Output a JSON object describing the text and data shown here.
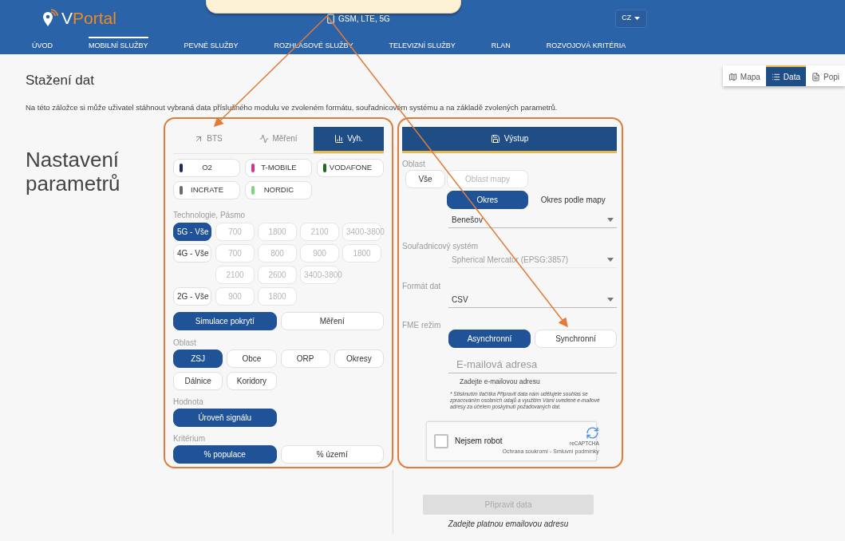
{
  "header": {
    "logo": {
      "initial": "V",
      "name": "Portal"
    },
    "network": "GSM, LTE, 5G",
    "language": "CZ"
  },
  "nav": [
    {
      "label": "ÚVOD",
      "selected": false
    },
    {
      "label": "MOBILNÍ SLUŽBY",
      "selected": true
    },
    {
      "label": "PEVNÉ SLUŽBY",
      "selected": false
    },
    {
      "label": "ROZHLASOVÉ SLUŽBY",
      "selected": false
    },
    {
      "label": "TELEVIZNÍ SLUŽBY",
      "selected": false
    },
    {
      "label": "RLAN",
      "selected": false
    },
    {
      "label": "ROZVOJOVÁ KRITÉRIA",
      "selected": false
    }
  ],
  "view_tabs": [
    {
      "kind": "map",
      "label": "Mapa",
      "selected": false
    },
    {
      "kind": "list",
      "label": "Data",
      "selected": true
    },
    {
      "kind": "document",
      "label": "Popi",
      "selected": false
    }
  ],
  "page": {
    "title": "Stažení dat",
    "description": "Na této záložce si může uživatel stáhnout vybraná data příslušného modulu ve zvoleném formátu, souřadnicovém systému a na základě zvolených parametrů.",
    "heading": "Nastavení parametrů"
  },
  "parameters": {
    "tabs": [
      {
        "kind": "bts",
        "label": "BTS",
        "selected": false
      },
      {
        "kind": "measurement",
        "label": "Měření",
        "selected": false
      },
      {
        "kind": "results",
        "label": "Vyh.",
        "selected": true
      }
    ],
    "operators": [
      {
        "name": "O2",
        "color": "#1a2a6c"
      },
      {
        "name": "T-MOBILE",
        "color": "#d6338a"
      },
      {
        "name": "VODAFONE",
        "color": "#1e6b1e"
      },
      {
        "name": "INCRATE",
        "color": "#6b6b6b"
      },
      {
        "name": "NORDIC",
        "color": "#7fd67f"
      }
    ],
    "technology": {
      "label": "Technologie, Pásmo",
      "rows": [
        {
          "generation": {
            "label": "5G - Vše",
            "selected": true
          },
          "bands": [
            {
              "label": "700",
              "disabled": true
            },
            {
              "label": "1800",
              "disabled": true
            },
            {
              "label": "2100",
              "disabled": true
            },
            {
              "label": "3400-3800",
              "disabled": true
            }
          ]
        },
        {
          "generation": {
            "label": "4G - Vše",
            "selected": false
          },
          "bands": [
            {
              "label": "700",
              "disabled": true
            },
            {
              "label": "800",
              "disabled": true
            },
            {
              "label": "900",
              "disabled": true
            },
            {
              "label": "1800",
              "disabled": true
            },
            {
              "label": "2100",
              "disabled": true
            },
            {
              "label": "2600",
              "disabled": true
            },
            {
              "label": "3400-3800",
              "disabled": true
            }
          ]
        },
        {
          "generation": {
            "label": "2G - Vše",
            "selected": false
          },
          "bands": [
            {
              "label": "900",
              "disabled": true
            },
            {
              "label": "1800",
              "disabled": true
            }
          ]
        }
      ]
    },
    "data_source": [
      {
        "label": "Simulace pokrytí",
        "selected": true
      },
      {
        "label": "Měření",
        "selected": false
      }
    ],
    "area": {
      "label": "Oblast",
      "options": [
        {
          "label": "ZSJ",
          "selected": true
        },
        {
          "label": "Obce",
          "selected": false
        },
        {
          "label": "ORP",
          "selected": false
        },
        {
          "label": "Okresy",
          "selected": false
        },
        {
          "label": "Dálnice",
          "selected": false
        },
        {
          "label": "Koridory",
          "selected": false
        }
      ]
    },
    "value": {
      "label": "Hodnota",
      "options": [
        {
          "label": "Úroveň signálu",
          "selected": true
        }
      ]
    },
    "criterion": {
      "label": "Kritérium",
      "options": [
        {
          "label": "% populace",
          "selected": true
        },
        {
          "label": "% území",
          "selected": false
        }
      ]
    }
  },
  "output": {
    "title": "Výstup",
    "area": {
      "label": "Oblast",
      "options": [
        {
          "kind": "button",
          "label": "Vše",
          "selected": false,
          "disabled": false
        },
        {
          "kind": "button",
          "label": "Oblast mapy",
          "selected": false,
          "disabled": true
        },
        {
          "kind": "button",
          "label": "Okres",
          "selected": true,
          "disabled": false
        },
        {
          "kind": "text",
          "label": "Okres podle mapy",
          "selected": false,
          "disabled": false
        }
      ],
      "district": "Benešov"
    },
    "coordinate_system": {
      "label": "Souřadnicový systém",
      "value": "Spherical Mercator (EPSG:3857)",
      "disabled": true
    },
    "format": {
      "label": "Formát dat",
      "value": "CSV",
      "disabled": false
    },
    "fme_mode": {
      "label": "FME režim",
      "options": [
        {
          "label": "Asynchronní",
          "selected": true
        },
        {
          "label": "Synchronní",
          "selected": false
        }
      ]
    },
    "email": {
      "placeholder": "E-mailová adresa",
      "hint": "Zadejte e-mailovou adresu"
    },
    "consent": "* Stisknutím tlačítka Připravit data nám udělujete souhlas se zpracováním osobních údajů a využitím Vámi uvedené e-mailové adresy za účelem poskytnutí požadovaných dat.",
    "captcha": {
      "label": "Nejsem robot",
      "checked": false,
      "brand": "reCAPTCHA",
      "links": "Ochrana soukromí - Smluvní podmínky"
    }
  },
  "submit": {
    "label": "Připravit data",
    "disabled": true
  },
  "error": "Zadejte platnou emailovou adresu"
}
